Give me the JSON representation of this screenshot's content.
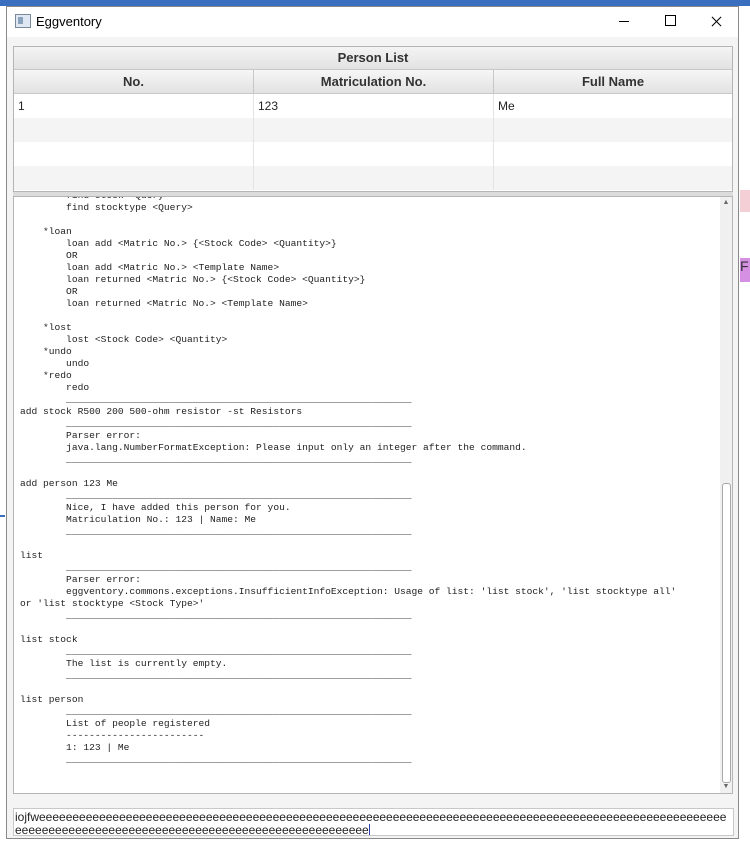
{
  "window": {
    "title": "Eggventory"
  },
  "person_table": {
    "title": "Person List",
    "columns": [
      "No.",
      "Matriculation No.",
      "Full Name"
    ],
    "rows": [
      {
        "no": "1",
        "matric": "123",
        "name": "Me"
      }
    ]
  },
  "console": {
    "text": "        find stock <Query>\n        find stocktype <Query>\n\n    *loan\n        loan add <Matric No.> {<Stock Code> <Quantity>}\n        OR\n        loan add <Matric No.> <Template Name>\n        loan returned <Matric No.> {<Stock Code> <Quantity>}\n        OR\n        loan returned <Matric No.> <Template Name>\n\n    *lost\n        lost <Stock Code> <Quantity>\n    *undo\n        undo\n    *redo\n        redo\n        ____________________________________________________________\nadd stock R500 200 500-ohm resistor -st Resistors\n        ____________________________________________________________\n        Parser error:\n        java.lang.NumberFormatException: Please input only an integer after the command.\n        ____________________________________________________________\n\nadd person 123 Me\n        ____________________________________________________________\n        Nice, I have added this person for you.\n        Matriculation No.: 123 | Name: Me\n        ____________________________________________________________\n\nlist\n        ____________________________________________________________\n        Parser error:\n        eggventory.commons.exceptions.InsufficientInfoException: Usage of list: 'list stock', 'list stocktype all'\nor 'list stocktype <Stock Type>'\n        ____________________________________________________________\n\nlist stock\n        ____________________________________________________________\n        The list is currently empty.\n        ____________________________________________________________\n\nlist person\n        ____________________________________________________________\n        List of people registered\n        ------------------------\n        1: 123 | Me\n        ____________________________________________________________"
  },
  "command_input": {
    "value": "iojfweeeeeeeeeeeeeeeeeeeeeeeeeeeeeeeeeeeeeeeeeeeeeeeeeeeeeeeeeeeeeeeeeeeeeeeeeeeeeeeeeeeeeeeeeeeeeeeeeeeeeeeeeeeeeeeeeeeeeeeeeeeeeeeeeeeeeeeeeeeeeeeeeeeeeeeeeeee"
  },
  "background": {
    "right_fragment_letter": "F"
  }
}
